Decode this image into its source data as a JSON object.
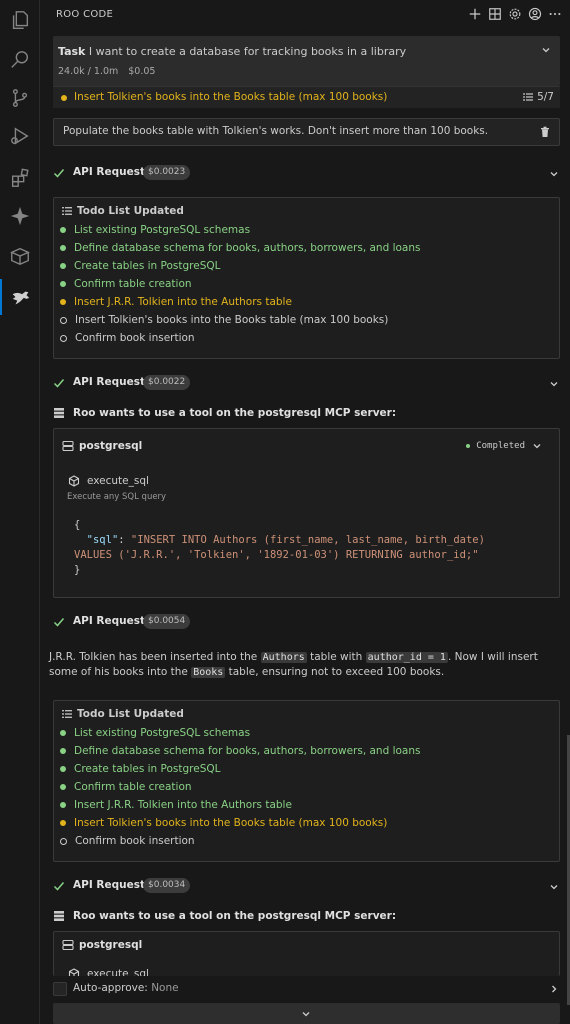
{
  "panel": {
    "title": "ROO CODE",
    "header_icons": [
      "plus-icon",
      "history-icon",
      "settings-icon",
      "account-icon",
      "more-icon"
    ]
  },
  "task": {
    "label": "Task",
    "text": "I want to create a database for tracking books in a library",
    "tokens": "24.0k / 1.0m",
    "cost": "$0.05",
    "current_todo": "Insert Tolkien's books into the Books table (max 100 books)",
    "progress": "5/7"
  },
  "user_message": "Populate the books table with Tolkien's works.  Don't insert more than 100 books.",
  "api_requests": [
    {
      "label": "API Request",
      "cost": "$0.0023"
    },
    {
      "label": "API Request",
      "cost": "$0.0022"
    },
    {
      "label": "API Request",
      "cost": "$0.0054"
    },
    {
      "label": "API Request",
      "cost": "$0.0034"
    }
  ],
  "todo1": {
    "title": "Todo List Updated",
    "items": [
      {
        "text": "List existing PostgreSQL schemas",
        "status": "done"
      },
      {
        "text": "Define database schema for books, authors, borrowers, and loans",
        "status": "done"
      },
      {
        "text": "Create tables in PostgreSQL",
        "status": "done"
      },
      {
        "text": "Confirm table creation",
        "status": "done"
      },
      {
        "text": "Insert J.R.R. Tolkien into the Authors table",
        "status": "progress"
      },
      {
        "text": "Insert Tolkien's books into the Books table (max 100 books)",
        "status": "pending"
      },
      {
        "text": "Confirm book insertion",
        "status": "pending"
      }
    ]
  },
  "todo2": {
    "title": "Todo List Updated",
    "items": [
      {
        "text": "List existing PostgreSQL schemas",
        "status": "done"
      },
      {
        "text": "Define database schema for books, authors, borrowers, and loans",
        "status": "done"
      },
      {
        "text": "Create tables in PostgreSQL",
        "status": "done"
      },
      {
        "text": "Confirm table creation",
        "status": "done"
      },
      {
        "text": "Insert J.R.R. Tolkien into the Authors table",
        "status": "done"
      },
      {
        "text": "Insert Tolkien's books into the Books table (max 100 books)",
        "status": "progress"
      },
      {
        "text": "Confirm book insertion",
        "status": "pending"
      }
    ]
  },
  "mcp1": {
    "label": "Roo wants to use a tool on the postgresql MCP server:",
    "server": "postgresql",
    "status": "Completed",
    "tool": "execute_sql",
    "tool_desc": "Execute any SQL query",
    "code_open": "{",
    "code_key": "\"sql\"",
    "code_sep": ": ",
    "code_val1": "\"INSERT INTO Authors (first_name, last_name, birth_date)",
    "code_val2": "VALUES ('J.R.R.', 'Tolkien', '1892-01-03') RETURNING author_id;\"",
    "code_close": "}"
  },
  "mcp2": {
    "label": "Roo wants to use a tool on the postgresql MCP server:",
    "server": "postgresql",
    "tool": "execute_sql"
  },
  "message": {
    "p1": "J.R.R. Tolkien has been inserted into the ",
    "c1": "Authors",
    "p2": " table with ",
    "c2": "author_id = 1",
    "p3": ". Now I will insert some of his books into the ",
    "c3": "Books",
    "p4": " table, ensuring not to exceed 100 books."
  },
  "autoapprove": {
    "label": "Auto-approve:",
    "value": "None"
  },
  "colors": {
    "done": "#89d185",
    "progress": "#e2b31c",
    "accent": "#0078d4"
  }
}
